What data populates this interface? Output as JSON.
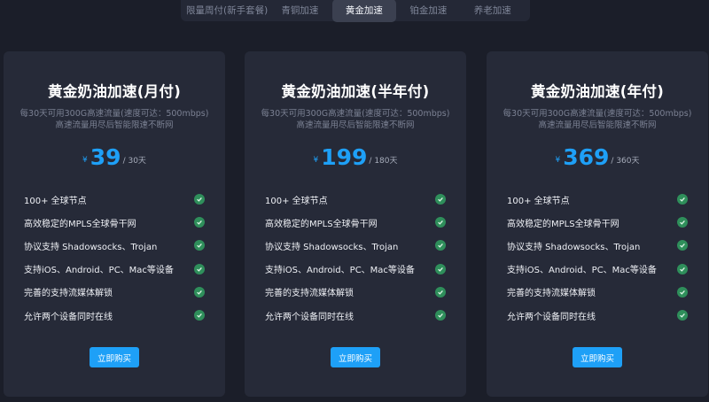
{
  "tabs": [
    {
      "label": "限量周付(新手套餐)"
    },
    {
      "label": "青铜加速"
    },
    {
      "label": "黄金加速"
    },
    {
      "label": "铂金加速"
    },
    {
      "label": "养老加速"
    }
  ],
  "active_tab": "黄金加速",
  "colors": {
    "accent": "#1ea0f7",
    "check": "#2f8f5b",
    "card": "#262a38",
    "background": "#1b1e29"
  },
  "cards": [
    {
      "title": "黄金奶油加速(月付)",
      "desc_line1": "每30天可用300G高速流量(速度可达：500mbps)",
      "desc_line2": "高速流量用尽后智能限速不断网",
      "currency": "¥",
      "price": "39",
      "period": "/ 30天",
      "features": [
        "100+ 全球节点",
        "高效稳定的MPLS全球骨干网",
        "协议支持 Shadowsocks、Trojan",
        "支持iOS、Android、PC、Mac等设备",
        "完善的支持流媒体解锁",
        "允许两个设备同时在线"
      ],
      "button": "立即购买"
    },
    {
      "title": "黄金奶油加速(半年付)",
      "desc_line1": "每30天可用300G高速流量(速度可达：500mbps)",
      "desc_line2": "高速流量用尽后智能限速不断网",
      "currency": "¥",
      "price": "199",
      "period": "/ 180天",
      "features": [
        "100+ 全球节点",
        "高效稳定的MPLS全球骨干网",
        "协议支持 Shadowsocks、Trojan",
        "支持iOS、Android、PC、Mac等设备",
        "完善的支持流媒体解锁",
        "允许两个设备同时在线"
      ],
      "button": "立即购买"
    },
    {
      "title": "黄金奶油加速(年付)",
      "desc_line1": "每30天可用300G高速流量(速度可达：500mbps)",
      "desc_line2": "高速流量用尽后智能限速不断网",
      "currency": "¥",
      "price": "369",
      "period": "/ 360天",
      "features": [
        "100+ 全球节点",
        "高效稳定的MPLS全球骨干网",
        "协议支持 Shadowsocks、Trojan",
        "支持iOS、Android、PC、Mac等设备",
        "完善的支持流媒体解锁",
        "允许两个设备同时在线"
      ],
      "button": "立即购买"
    }
  ]
}
